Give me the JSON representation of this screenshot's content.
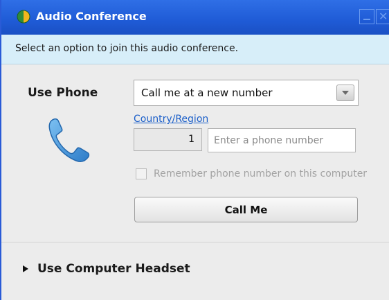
{
  "window": {
    "title": "Audio Conference",
    "icon": "globe-icon",
    "minimize_icon": "minimize-icon",
    "close_icon": "close-icon",
    "close_glyph": "✕"
  },
  "banner": {
    "text": "Select an option to join this audio conference."
  },
  "use_phone": {
    "label": "Use Phone",
    "icon": "phone-handset-icon",
    "dropdown": {
      "selected": "Call me at a new number",
      "arrow_icon": "chevron-down-icon"
    },
    "country_link": "Country/Region",
    "country_code": "1",
    "phone_input": {
      "value": "",
      "placeholder": "Enter a phone number"
    },
    "remember": {
      "label": "Remember phone number on this computer",
      "checked": false,
      "enabled": false
    },
    "call_button": "Call Me"
  },
  "headset": {
    "label": "Use Computer Headset",
    "expand_icon": "triangle-right-icon",
    "expanded": false
  },
  "colors": {
    "titlebar": "#1f5bd6",
    "banner": "#d7eef9",
    "link": "#1a5ec9",
    "phone_icon": "#3f8fd8"
  }
}
